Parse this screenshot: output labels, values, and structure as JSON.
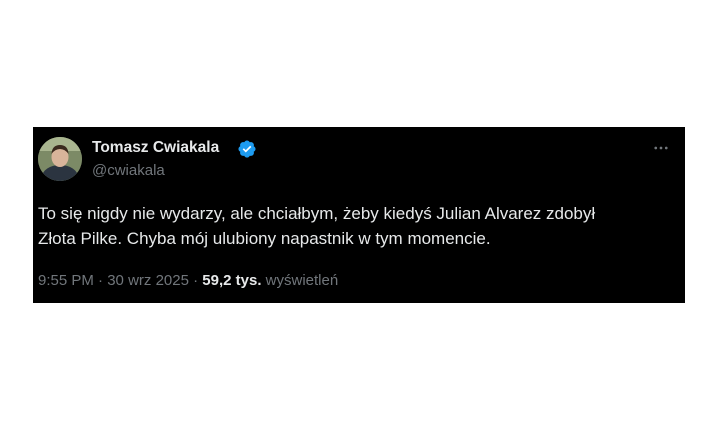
{
  "author": {
    "name": "Tomasz Cwiakala",
    "handle": "@cwiakala",
    "verified": true,
    "badge_color": "#1d9bf0"
  },
  "tweet": {
    "line1": "To się nigdy nie wydarzy, ale chciałbym, żeby kiedyś Julian Alvarez zdobył",
    "line2": "Złota Pilke. Chyba mój ulubiony napastnik w tym momencie."
  },
  "meta": {
    "time": "9:55 PM",
    "separator1": " · ",
    "date": "30 wrz 2025",
    "separator2": " · ",
    "views_count": "59,2 tys.",
    "views_label": " wyświetleń"
  },
  "colors": {
    "card_background": "#000000",
    "primary_text": "#e7e9ea",
    "secondary_text": "#71767b"
  },
  "icons": {
    "verified": "verified-badge-icon",
    "more": "more-horizontal-icon"
  }
}
